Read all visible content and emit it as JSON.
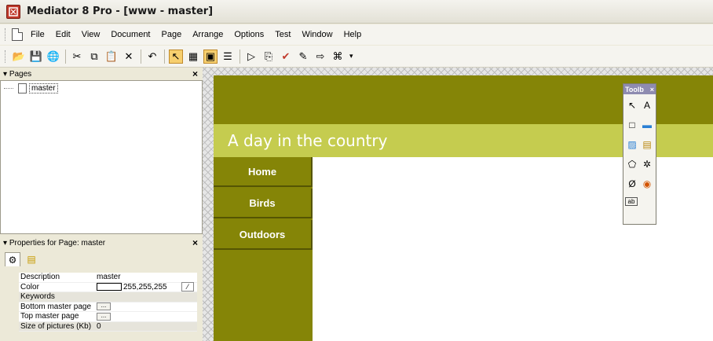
{
  "window": {
    "title": "Mediator 8 Pro - [www - master]"
  },
  "menu": {
    "items": [
      {
        "label": "File"
      },
      {
        "label": "Edit"
      },
      {
        "label": "View"
      },
      {
        "label": "Document"
      },
      {
        "label": "Page"
      },
      {
        "label": "Arrange"
      },
      {
        "label": "Options"
      },
      {
        "label": "Test"
      },
      {
        "label": "Window"
      },
      {
        "label": "Help"
      }
    ]
  },
  "toolbar": {
    "buttons": [
      {
        "icon": "open-folder-icon",
        "glyph": "📂"
      },
      {
        "icon": "save-icon",
        "glyph": "💾"
      },
      {
        "icon": "publish-icon",
        "glyph": "🌐"
      },
      {
        "icon": "cut-icon",
        "glyph": "✂"
      },
      {
        "icon": "copy-icon",
        "glyph": "⧉"
      },
      {
        "icon": "paste-icon",
        "glyph": "📋"
      },
      {
        "icon": "delete-icon",
        "glyph": "✕"
      },
      {
        "icon": "undo-icon",
        "glyph": "↶"
      },
      {
        "icon": "select-mode-icon",
        "glyph": "↖"
      },
      {
        "icon": "design-view-icon",
        "glyph": "▦"
      },
      {
        "icon": "preview-icon",
        "glyph": "▣"
      },
      {
        "icon": "layout-icon",
        "glyph": "☰"
      },
      {
        "icon": "play-icon",
        "glyph": "▷"
      },
      {
        "icon": "browser-preview-icon",
        "glyph": "⎘"
      },
      {
        "icon": "check-icon",
        "glyph": "✔"
      },
      {
        "icon": "properties-icon",
        "glyph": "✎"
      },
      {
        "icon": "export-icon",
        "glyph": "⇨"
      },
      {
        "icon": "html-icon",
        "glyph": "⌘"
      }
    ]
  },
  "pages_panel": {
    "title": "Pages",
    "tree": [
      {
        "label": "master"
      }
    ]
  },
  "properties_panel": {
    "title": "Properties for Page: master",
    "rows": [
      {
        "name": "Description",
        "value": "master"
      },
      {
        "name": "Color",
        "value": "255,255,255",
        "swatch": "#ffffff"
      },
      {
        "name": "Keywords",
        "value": ""
      },
      {
        "name": "Bottom master page",
        "value": ""
      },
      {
        "name": "Top master page",
        "value": ""
      },
      {
        "name": "Size of pictures (Kb)",
        "value": "0"
      }
    ]
  },
  "site": {
    "banner_title": "A day in the country",
    "nav": [
      {
        "label": "Home"
      },
      {
        "label": "Birds"
      },
      {
        "label": "Outdoors"
      }
    ],
    "colors": {
      "header": "#858507",
      "banner": "#c5cc4f",
      "sidebar": "#858507",
      "text": "#ffffff"
    }
  },
  "toolbox": {
    "title": "Toolb",
    "tools": [
      {
        "icon": "pointer-icon",
        "glyph": "↖"
      },
      {
        "icon": "text-tool-icon",
        "glyph": "A"
      },
      {
        "icon": "rectangle-tool-icon",
        "glyph": "□"
      },
      {
        "icon": "button-tool-icon",
        "glyph": "▬"
      },
      {
        "icon": "image-tool-icon",
        "glyph": "▨"
      },
      {
        "icon": "media-tool-icon",
        "glyph": "▤"
      },
      {
        "icon": "polygon-tool-icon",
        "glyph": "⬠"
      },
      {
        "icon": "line-tool-icon",
        "glyph": "✲"
      },
      {
        "icon": "flash-tool-icon",
        "glyph": "Ø"
      },
      {
        "icon": "rollover-tool-icon",
        "glyph": "◉"
      },
      {
        "icon": "form-field-tool-icon",
        "glyph": "ab"
      }
    ]
  }
}
